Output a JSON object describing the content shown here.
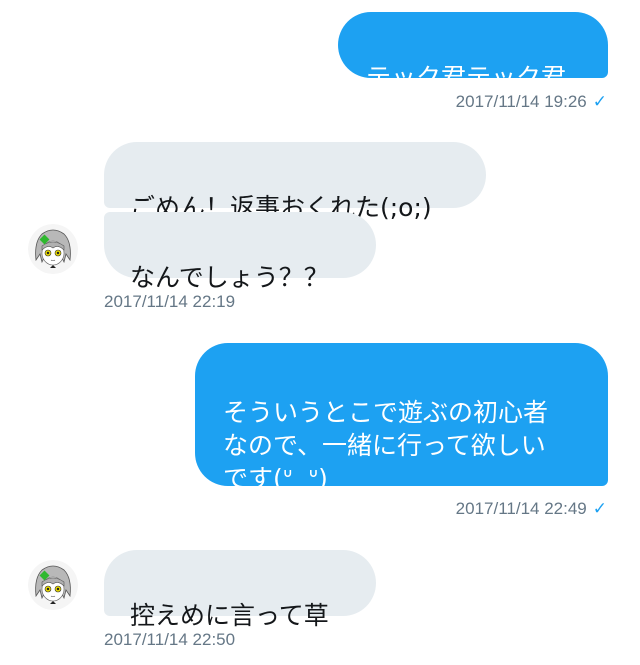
{
  "messages": [
    {
      "text": "テック君テック君",
      "time": "2017/11/14 19:26",
      "read": true
    },
    {
      "text": "ごめん！返事おくれた(;o;)"
    },
    {
      "text": "なんでしょう？？",
      "time": "2017/11/14 22:19"
    },
    {
      "text": "そういうとこで遊ぶの初心者\nなので、一緒に行って欲しい\nです(ᐡ ̫ ᐡ)",
      "time": "2017/11/14 22:49",
      "read": true
    },
    {
      "text": "控えめに言って草",
      "time": "2017/11/14 22:50"
    }
  ],
  "icons": {
    "read_check": "checkmark-icon",
    "avatar": "anime-character-avatar"
  },
  "colors": {
    "outgoing_bubble": "#1da1f2",
    "incoming_bubble": "#e6ecf0",
    "timestamp": "#657786"
  }
}
